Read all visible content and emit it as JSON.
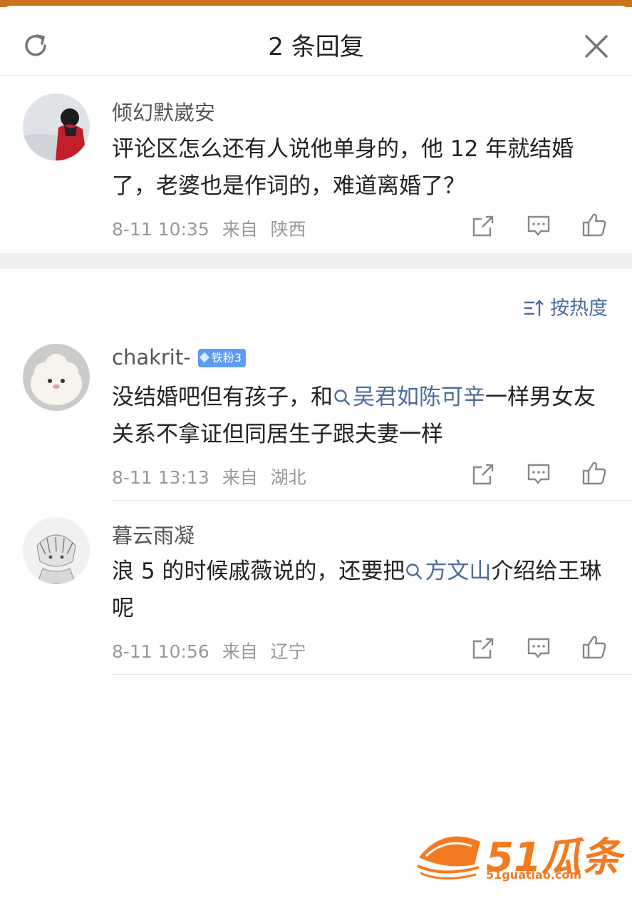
{
  "header": {
    "title": "2 条回复"
  },
  "main_comment": {
    "username": "倾幻默崴安",
    "text": "评论区怎么还有人说他单身的，他 12 年就结婚了，老婆也是作词的，难道离婚了？",
    "date": "8-11 10:35",
    "from_label": "来自",
    "location": "陕西"
  },
  "sort": {
    "label": "按热度"
  },
  "replies": [
    {
      "username": "chakrit-",
      "badge": "铁粉3",
      "text_before": "没结婚吧但有孩子，和",
      "link": "吴君如陈可辛",
      "text_after": "一样男女友关系不拿证但同居生子跟夫妻一样",
      "date": "8-11 13:13",
      "from_label": "来自",
      "location": "湖北"
    },
    {
      "username": "暮云雨凝",
      "text_before": "浪 5 的时候戚薇说的，还要把",
      "link": "方文山",
      "text_after": "介绍给王琳呢",
      "date": "8-11 10:56",
      "from_label": "来自",
      "location": "辽宁"
    }
  ],
  "watermark": {
    "text": "51瓜条",
    "url": "51guatiao.com"
  },
  "colors": {
    "link": "#4d6d97",
    "badge": "#5c9cf2",
    "watermark": "#f47a1f",
    "topstrip": "#c8741f"
  },
  "icons": [
    "refresh-icon",
    "close-icon",
    "share-icon",
    "comment-icon",
    "like-icon",
    "search-icon",
    "sort-icon"
  ]
}
